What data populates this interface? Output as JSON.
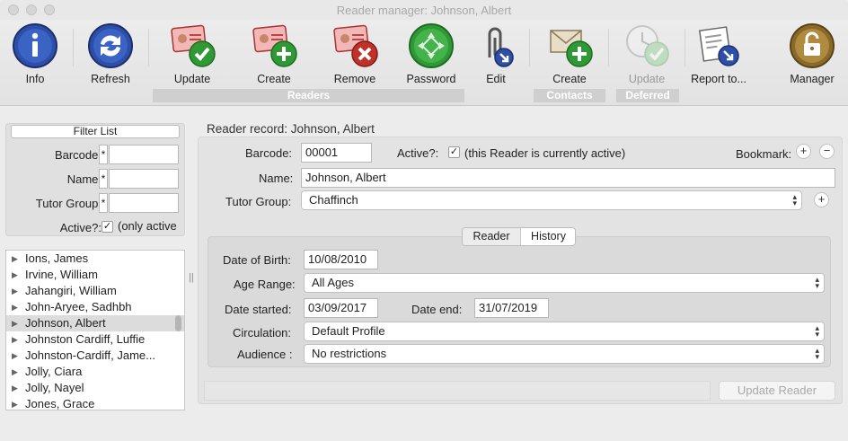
{
  "window": {
    "title": "Reader manager: Johnson, Albert"
  },
  "toolbar": {
    "items": [
      {
        "label": "Info",
        "icon": "info-icon"
      },
      {
        "label": "Refresh",
        "icon": "refresh-icon"
      },
      {
        "label": "Update",
        "icon": "reader-card-check-icon"
      },
      {
        "label": "Create",
        "icon": "reader-card-add-icon"
      },
      {
        "label": "Remove",
        "icon": "reader-card-remove-icon"
      },
      {
        "label": "Password",
        "icon": "password-icon"
      },
      {
        "label": "Edit",
        "icon": "paperclip-edit-icon"
      },
      {
        "label": "Create",
        "icon": "envelope-add-icon"
      },
      {
        "label": "Update",
        "icon": "clock-check-icon"
      },
      {
        "label": "Report to...",
        "icon": "report-icon"
      },
      {
        "label": "Manager",
        "icon": "padlock-icon"
      }
    ],
    "groups": {
      "readers": "Readers",
      "contacts": "Contacts",
      "deferred": "Deferred"
    }
  },
  "filter": {
    "button_label": "Filter List",
    "barcode_label": "Barcode:",
    "name_label": "Name:",
    "tutor_label": "Tutor Group:",
    "wildcard": "*",
    "active_label": "Active?:",
    "active_text": "(only active",
    "active_checked": true
  },
  "reader_list": {
    "items": [
      {
        "name": "Ions,  James",
        "selected": false
      },
      {
        "name": "Irvine,  William",
        "selected": false
      },
      {
        "name": "Jahangiri,  William",
        "selected": false
      },
      {
        "name": "John-Aryee,  Sadhbh",
        "selected": false
      },
      {
        "name": "Johnson, Albert",
        "selected": true
      },
      {
        "name": "Johnston Cardiff,  Luffie",
        "selected": false
      },
      {
        "name": "Johnston-Cardiff,  Jame...",
        "selected": false
      },
      {
        "name": "Jolly,  Ciara",
        "selected": false
      },
      {
        "name": "Jolly,  Nayel",
        "selected": false
      },
      {
        "name": "Jones,  Grace",
        "selected": false
      }
    ]
  },
  "record": {
    "title": "Reader record: Johnson, Albert",
    "barcode_label": "Barcode:",
    "barcode_value": "00001",
    "active_label": "Active?:",
    "active_text": "(this Reader is currently active)",
    "active_checked": true,
    "bookmark_label": "Bookmark:",
    "name_label": "Name:",
    "name_value": "Johnson, Albert",
    "tutor_label": "Tutor Group:",
    "tutor_value": "Chaffinch",
    "tabs": [
      "Reader",
      "History"
    ],
    "dob_label": "Date of Birth:",
    "dob_value": "10/08/2010",
    "age_label": "Age Range:",
    "age_value": "All Ages",
    "date_started_label": "Date started:",
    "date_started_value": "03/09/2017",
    "date_end_label": "Date end:",
    "date_end_value": "31/07/2019",
    "circulation_label": "Circulation:",
    "circulation_value": "Default Profile",
    "audience_label": "Audience :",
    "audience_value": "No restrictions",
    "update_button": "Update Reader"
  }
}
